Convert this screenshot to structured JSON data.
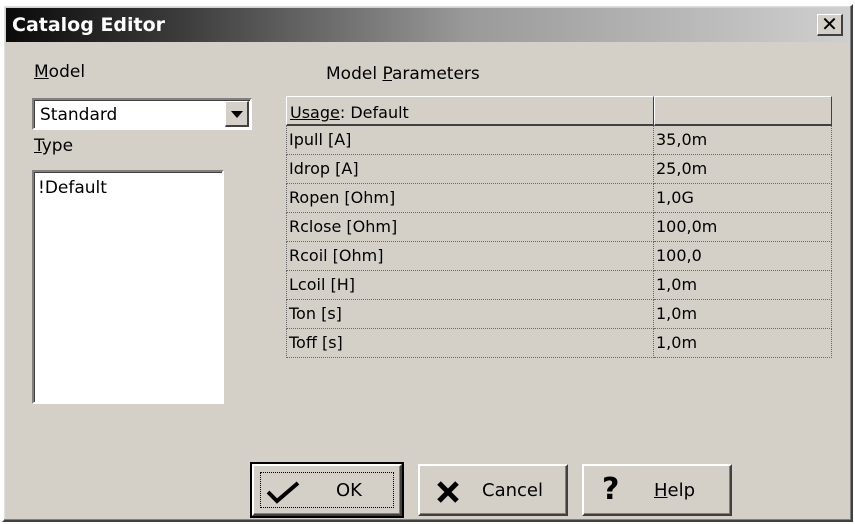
{
  "window": {
    "title": "Catalog Editor",
    "close_glyph": "✕"
  },
  "model": {
    "label": "Model",
    "value": "Standard"
  },
  "type": {
    "label": "Type",
    "items": [
      "!Default"
    ]
  },
  "parameters": {
    "label": "Model Parameters",
    "header": [
      "Usage: Default",
      ""
    ],
    "rows": [
      [
        "Ipull [A]",
        "35,0m"
      ],
      [
        "Idrop [A]",
        "25,0m"
      ],
      [
        "Ropen [Ohm]",
        "1,0G"
      ],
      [
        "Rclose [Ohm]",
        "100,0m"
      ],
      [
        "Rcoil [Ohm]",
        "100,0"
      ],
      [
        "Lcoil [H]",
        "1,0m"
      ],
      [
        "Ton [s]",
        "1,0m"
      ],
      [
        "Toff [s]",
        "1,0m"
      ]
    ]
  },
  "buttons": {
    "ok": {
      "label": "OK",
      "icon": "check-icon"
    },
    "cancel": {
      "label": "Cancel",
      "icon": "x-icon"
    },
    "help": {
      "label": "Help",
      "icon": "question-icon"
    }
  }
}
